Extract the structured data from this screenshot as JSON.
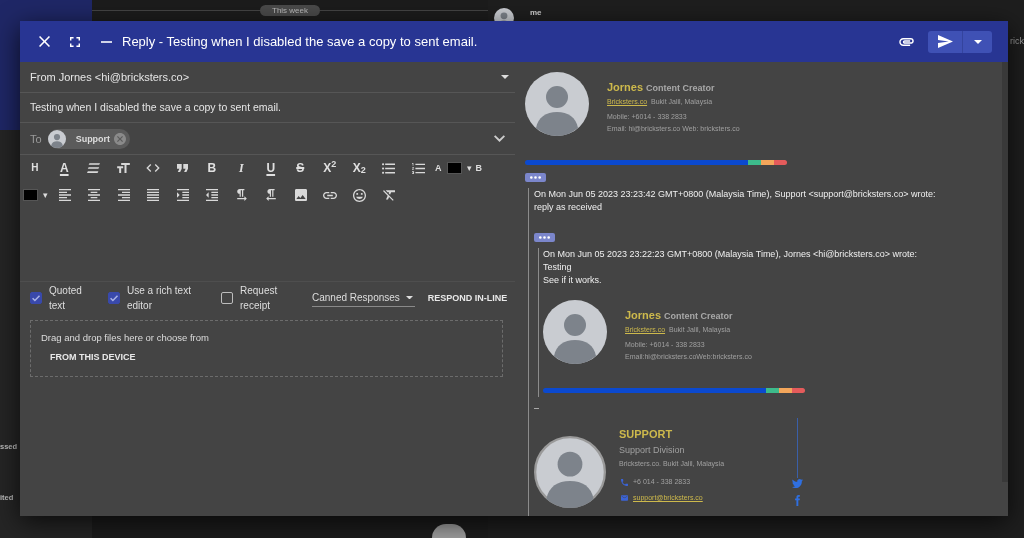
{
  "background": {
    "divider_label": "This week",
    "sender": "me",
    "sidebar_items": [
      "ssed",
      "ited"
    ],
    "edge_text": "rick"
  },
  "window": {
    "title": "Reply - Testing when I disabled the save a copy to sent email."
  },
  "compose": {
    "from": "From Jornes <hi@bricksters.co>",
    "subject": "Testing when I disabled the save a copy to sent email.",
    "to_label": "To",
    "recipients": [
      {
        "name": "Support"
      }
    ],
    "toolbar": [
      [
        {
          "kind": "letter",
          "label": "H"
        },
        {
          "kind": "letter",
          "label": "A"
        },
        {
          "kind": "icon"
        },
        {
          "kind": "icon"
        },
        {
          "kind": "icon"
        },
        {
          "kind": "icon"
        },
        {
          "kind": "letter",
          "label": "B"
        },
        {
          "kind": "letter",
          "label": "I"
        },
        {
          "kind": "letter",
          "label": "U"
        },
        {
          "kind": "letter",
          "label": "S"
        },
        {
          "kind": "letter",
          "label": "X$^{2}$"
        },
        {
          "kind": "letter",
          "label": "X$_{2}$"
        },
        {
          "kind": "icon"
        },
        {
          "kind": "icon"
        },
        {
          "kind": "small",
          "label": "A"
        },
        {
          "kind": "swatch",
          "color": "#000000"
        },
        {
          "kind": "caret",
          "label": "▾"
        },
        {
          "kind": "small",
          "label": "B"
        }
      ],
      [
        {
          "kind": "swatch",
          "color": "#000000"
        },
        {
          "kind": "caret",
          "label": "▾"
        },
        {
          "kind": "icon"
        },
        {
          "kind": "icon"
        },
        {
          "kind": "icon"
        },
        {
          "kind": "icon"
        },
        {
          "kind": "icon"
        },
        {
          "kind": "icon"
        },
        {
          "kind": "icon"
        },
        {
          "kind": "icon"
        },
        {
          "kind": "icon"
        },
        {
          "kind": "icon"
        },
        {
          "kind": "icon"
        },
        {
          "kind": "icon"
        }
      ]
    ],
    "options": [
      {
        "label": "Quoted text",
        "checked": true
      },
      {
        "label": "Use a rich text editor",
        "checked": true
      },
      {
        "label": "Request receipt",
        "checked": false
      }
    ],
    "canned_responses": "Canned Responses",
    "respond_inline": "RESPOND IN-LINE",
    "dropzone": {
      "text": "Drag and drop files here or choose from",
      "button": "FROM THIS DEVICE"
    }
  },
  "preview": {
    "signature": {
      "name": "Jornes",
      "role": "Content Creator",
      "company": "Bricksters.co",
      "location": "Bukit Jalil, Malaysia",
      "mobile": "Mobile: +6014 - 338 2833",
      "contact": "Email: hi@bricksters.co Web: bricksters.co"
    },
    "quote": {
      "header": "On Mon Jun 05 2023 23:23:42 GMT+0800 (Malaysia Time), Support <support@bricksters.co> wrote:",
      "body": [
        "reply as received"
      ],
      "quote": {
        "header": "On Mon Jun 05 2023 23:22:23 GMT+0800 (Malaysia Time), Jornes <hi@bricksters.co> wrote:",
        "body": [
          "Testing",
          "See if it works."
        ],
        "signature": {
          "name": "Jornes",
          "role": "Content Creator",
          "company": "Bricksters.co",
          "location": "Bukit Jalil, Malaysia",
          "mobile": "Mobile: +6014 - 338 2833",
          "contact": "Email:hi@bricksters.coWeb:bricksters.co"
        }
      },
      "separator": "–",
      "support_signature": {
        "name": "SUPPORT",
        "department": "Support Division",
        "address": "Bricksters.co. Bukit Jalil, Malaysia",
        "phone": "+6 014 - 338 2833",
        "email": "support@bricksters.co"
      }
    }
  }
}
